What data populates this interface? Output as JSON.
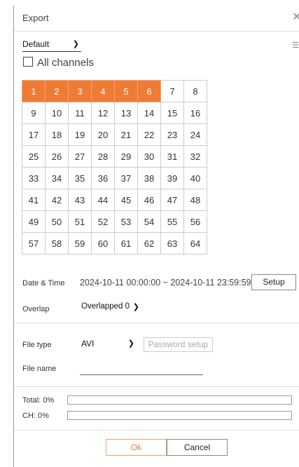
{
  "dialog": {
    "title": "Export"
  },
  "preset": {
    "selected": "Default"
  },
  "all_channels_label": "All channels",
  "channels": {
    "rows": [
      [
        "1",
        "2",
        "3",
        "4",
        "5",
        "6",
        "7",
        "8"
      ],
      [
        "9",
        "10",
        "11",
        "12",
        "13",
        "14",
        "15",
        "16"
      ],
      [
        "17",
        "18",
        "19",
        "20",
        "21",
        "22",
        "23",
        "24"
      ],
      [
        "25",
        "26",
        "27",
        "28",
        "29",
        "30",
        "31",
        "32"
      ],
      [
        "33",
        "34",
        "35",
        "36",
        "37",
        "38",
        "39",
        "40"
      ],
      [
        "41",
        "42",
        "43",
        "44",
        "45",
        "46",
        "47",
        "48"
      ],
      [
        "49",
        "50",
        "51",
        "52",
        "53",
        "54",
        "55",
        "56"
      ],
      [
        "57",
        "58",
        "59",
        "60",
        "61",
        "62",
        "63",
        "64"
      ]
    ],
    "selected": [
      "1",
      "2",
      "3",
      "4",
      "5",
      "6"
    ],
    "selected_color": "#f07b35"
  },
  "datetime": {
    "label": "Date & Time",
    "value": "2024-10-11 00:00:00 ~ 2024-10-11 23:59:59",
    "setup_button": "Setup"
  },
  "overlap": {
    "label": "Overlap",
    "selected": "Overlapped 0"
  },
  "file_type": {
    "label": "File type",
    "selected": "AVI",
    "password_button": "Password setup"
  },
  "file_name": {
    "label": "File name",
    "value": ""
  },
  "progress": {
    "total_label": "Total: 0%",
    "total_value": 0,
    "ch_label": "CH: 0%",
    "ch_value": 0
  },
  "footer": {
    "ok_label": "Ok",
    "cancel_label": "Cancel"
  },
  "icons": {
    "close": "close-icon",
    "list": "list-icon",
    "dropdown": "chevron-down-icon"
  }
}
